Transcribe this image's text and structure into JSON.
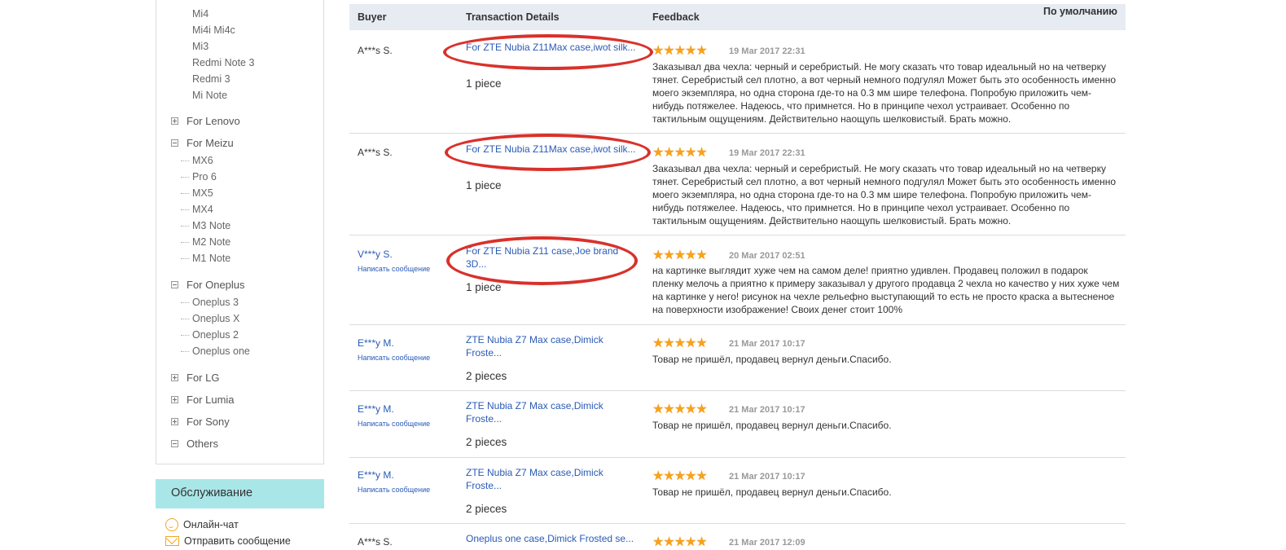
{
  "sidebar": {
    "top_items": [
      "Mi4",
      "Mi4i Mi4c",
      "Mi3",
      "Redmi Note 3",
      "Redmi 3",
      "Mi Note"
    ],
    "lenovo": "For Lenovo",
    "meizu": "For Meizu",
    "meizu_items": [
      "MX6",
      "Pro 6",
      "MX5",
      "MX4",
      "M3 Note",
      "M2 Note",
      "M1 Note"
    ],
    "oneplus": "For Oneplus",
    "oneplus_items": [
      "Oneplus 3",
      "Oneplus X",
      "Oneplus 2",
      "Oneplus one"
    ],
    "lg": "For LG",
    "lumia": "For Lumia",
    "sony": "For Sony",
    "others": "Others"
  },
  "service": {
    "title": "Обслуживание",
    "chat": "Онлайн-чат",
    "send": "Отправить сообщение"
  },
  "table": {
    "col_buyer": "Buyer",
    "col_details": "Transaction Details",
    "col_feedback": "Feedback",
    "sort": "По умолчанию",
    "rows": [
      {
        "buyer": "A***s S.",
        "msg": "",
        "product": "For ZTE Nubia Z11Max case,iwot silk...",
        "qty": "1 piece",
        "stars": "★★★★★",
        "date": "19 Mar 2017 22:31",
        "feedback": "Заказывал два чехла: черный и серебристый. Не могу сказать что товар идеальный но на четверку тянет. Серебристый сел плотно, а вот черный немного подгулял Может быть это особенность именно моего экземпляра, но одна сторона где-то на 0.3 мм шире телефона. Попробую приложить чем-нибудь потяжелее. Надеюсь, что примнется. Но в принципе чехол устраивает. Особенно по тактильным ощущениям. Действительно наощупь шелковистый. Брать можно."
      },
      {
        "buyer": "A***s S.",
        "msg": "",
        "product": "For ZTE Nubia Z11Max case,iwot silk...",
        "qty": "1 piece",
        "stars": "★★★★★",
        "date": "19 Mar 2017 22:31",
        "feedback": "Заказывал два чехла: черный и серебристый. Не могу сказать что товар идеальный но на четверку тянет. Серебристый сел плотно, а вот черный немного подгулял Может быть это особенность именно моего экземпляра, но одна сторона где-то на 0.3 мм шире телефона. Попробую приложить чем-нибудь потяжелее. Надеюсь, что примнется. Но в принципе чехол устраивает. Особенно по тактильным ощущениям. Действительно наощупь шелковистый. Брать можно."
      },
      {
        "buyer": "V***y S.",
        "msg": "Написать сообщение",
        "product": "For ZTE Nubia Z11 case,Joe brand 3D...",
        "qty": "1 piece",
        "stars": "★★★★★",
        "date": "20 Mar 2017 02:51",
        "feedback": "на картинке выглядит хуже чем на самом деле! приятно удивлен. Продавец положил в подарок пленку мелочь а приятно к примеру заказывал у другого продавца 2 чехла но качество у них хуже чем на картинке у него! рисунок на чехле рельефно выступающий то есть не просто краска а вытесненое на поверхности изображение! Своих денег стоит 100%"
      },
      {
        "buyer": "E***y M.",
        "msg": "Написать сообщение",
        "product": "ZTE Nubia Z7 Max case,Dimick Froste...",
        "qty": "2 pieces",
        "stars": "★★★★★",
        "date": "21 Mar 2017 10:17",
        "feedback": "Товар не пришёл, продавец вернул деньги.Спасибо."
      },
      {
        "buyer": "E***y M.",
        "msg": "Написать сообщение",
        "product": "ZTE Nubia Z7 Max case,Dimick Froste...",
        "qty": "2 pieces",
        "stars": "★★★★★",
        "date": "21 Mar 2017 10:17",
        "feedback": "Товар не пришёл, продавец вернул деньги.Спасибо."
      },
      {
        "buyer": "E***y M.",
        "msg": "Написать сообщение",
        "product": "ZTE Nubia Z7 Max case,Dimick Froste...",
        "qty": "2 pieces",
        "stars": "★★★★★",
        "date": "21 Mar 2017 10:17",
        "feedback": "Товар не пришёл, продавец вернул деньги.Спасибо."
      },
      {
        "buyer": "A***s S.",
        "msg": "",
        "product": "Oneplus one case,Dimick Frosted se...",
        "qty": "",
        "stars": "★★★★★",
        "date": "21 Mar 2017 12:09",
        "feedback": ""
      }
    ]
  },
  "colors": {
    "accent": "#2a5ab6",
    "star": "#f7a21b",
    "highlight": "#d9312b",
    "service_bg": "#a9e6e8",
    "header_bg": "#e7ebf2"
  }
}
